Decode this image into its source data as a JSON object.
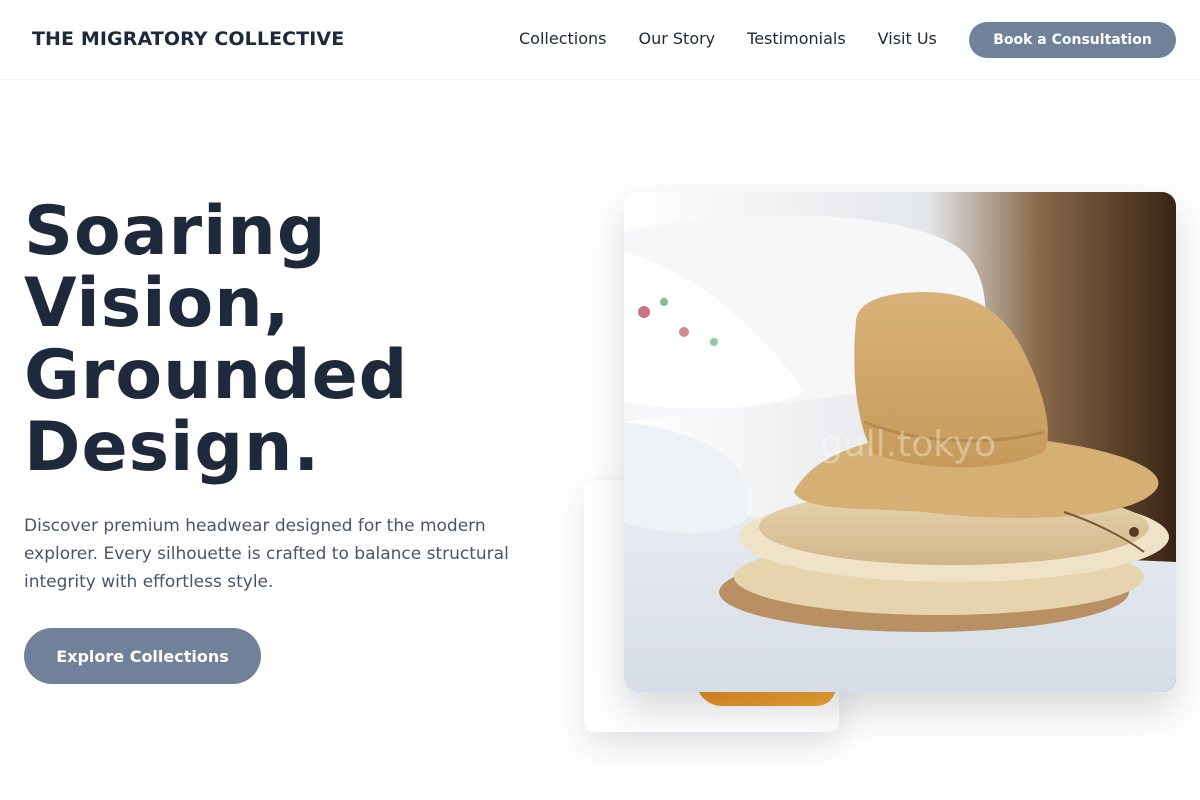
{
  "brand": {
    "name": "THE MIGRATORY COLLECTIVE"
  },
  "nav": {
    "links": [
      {
        "label": "Collections"
      },
      {
        "label": "Our Story"
      },
      {
        "label": "Testimonials"
      },
      {
        "label": "Visit Us"
      }
    ],
    "cta_label": "Book a Consultation"
  },
  "hero": {
    "title_lines": [
      "Soaring",
      "Vision,",
      "Grounded",
      "Design."
    ],
    "description": "Discover premium headwear designed for the modern explorer. Every silhouette is crafted to balance structural integrity with effortless style.",
    "cta_label": "Explore Collections"
  },
  "images": {
    "main": {
      "subject": "stacked straw hats on a bed",
      "watermark_text": "gull.tokyo"
    },
    "secondary": {
      "subject": "partially hidden product photo"
    }
  },
  "colors": {
    "primary_text": "#1e293b",
    "button_bg": "#708199",
    "button_text": "#ffffff",
    "body_text": "#4b5568",
    "accent": "#f4a52c"
  }
}
